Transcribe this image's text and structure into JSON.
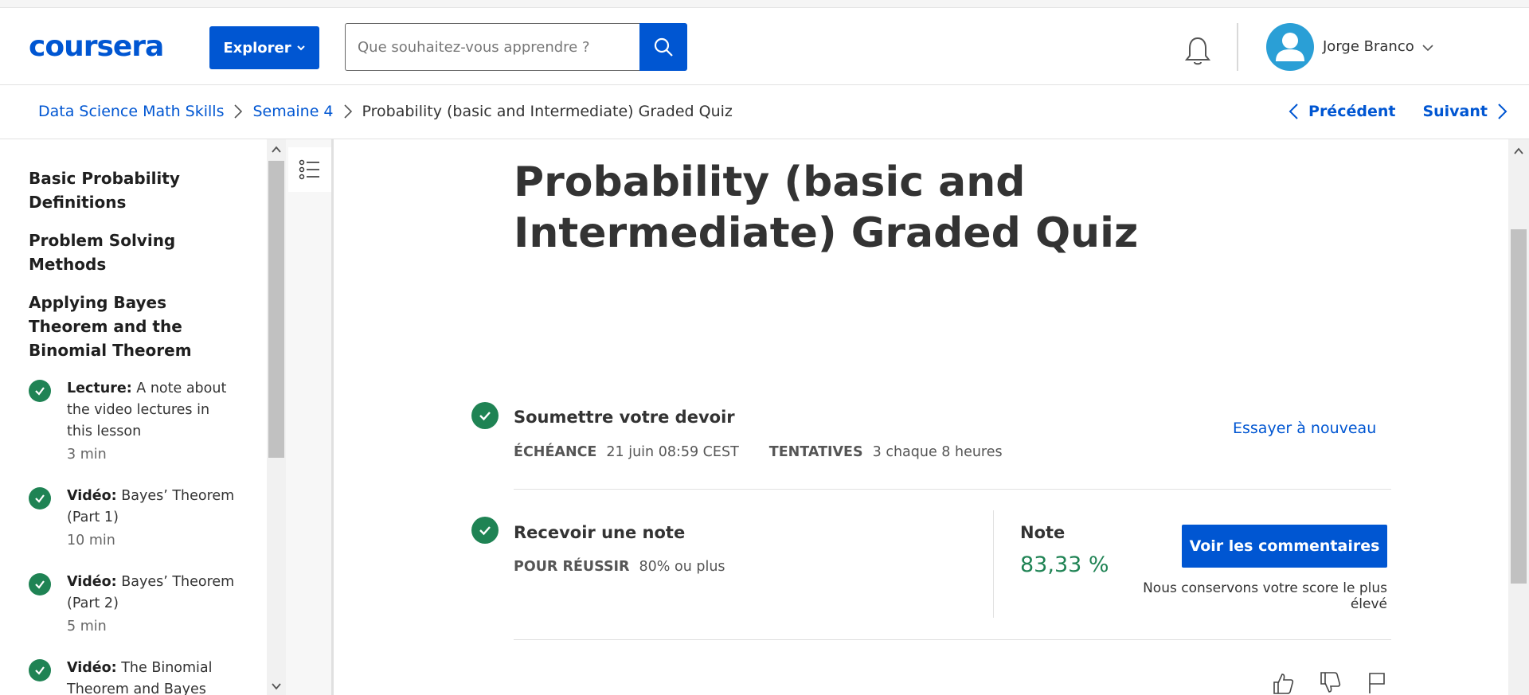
{
  "header": {
    "logo": "coursera",
    "explore_label": "Explorer",
    "search_placeholder": "Que souhaitez-vous apprendre ?",
    "user_name": "Jorge Branco"
  },
  "breadcrumb": {
    "items": [
      "Data Science Math Skills",
      "Semaine 4"
    ],
    "current": "Probability (basic and Intermediate) Graded Quiz",
    "prev_label": "Précédent",
    "next_label": "Suivant"
  },
  "sidebar": {
    "sections": [
      "Basic Probability Definitions",
      "Problem Solving Methods",
      "Applying Bayes Theorem and the Binomial Theorem"
    ],
    "lessons": [
      {
        "type": "Lecture:",
        "title": "A note about the video lectures in this lesson",
        "duration": "3 min"
      },
      {
        "type": "Vidéo:",
        "title": "Bayes’ Theorem (Part 1)",
        "duration": "10 min"
      },
      {
        "type": "Vidéo:",
        "title": "Bayes’ Theorem (Part 2)",
        "duration": "5 min"
      },
      {
        "type": "Vidéo:",
        "title": "The Binomial Theorem and Bayes",
        "duration": ""
      }
    ]
  },
  "main": {
    "title": "Probability (basic and Intermediate) Graded Quiz",
    "submit": {
      "title": "Soumettre votre devoir",
      "deadline_label": "ÉCHÉANCE",
      "deadline_value": "21 juin 08:59 CEST",
      "attempts_label": "TENTATIVES",
      "attempts_value": "3 chaque 8 heures",
      "retry_label": "Essayer à nouveau"
    },
    "grade": {
      "title": "Recevoir une note",
      "pass_label": "POUR RÉUSSIR",
      "pass_value": "80% ou plus",
      "note_label": "Note",
      "note_value": "83,33 %",
      "feedback_label": "Voir les commentaires",
      "keep_note": "Nous conservons votre score le plus élevé"
    }
  },
  "colors": {
    "brand": "#0056d2",
    "success": "#1f8354"
  },
  "icons": [
    "search-icon",
    "bell-icon",
    "user-icon",
    "chevron-down-icon",
    "chevron-right-icon",
    "chevron-left-icon",
    "list-icon",
    "check-icon",
    "thumbs-up-icon",
    "thumbs-down-icon",
    "flag-icon"
  ]
}
